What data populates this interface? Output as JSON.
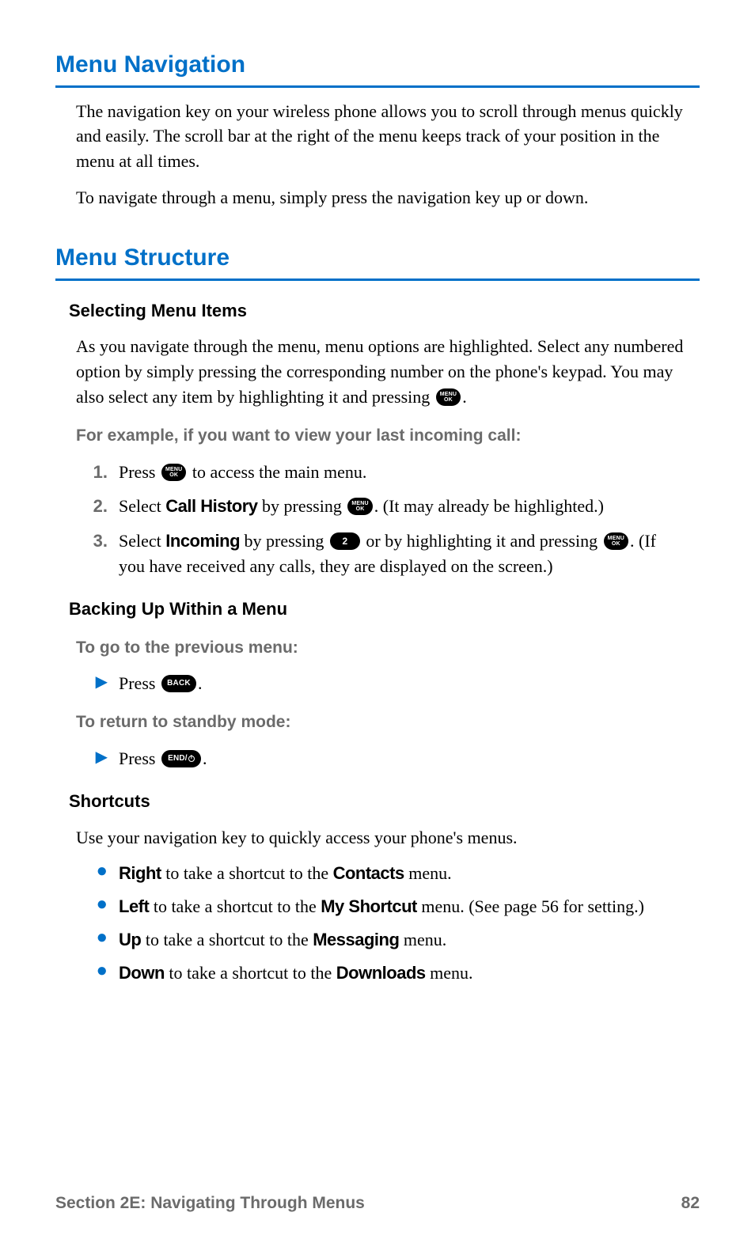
{
  "section1": {
    "heading": "Menu Navigation",
    "p1": "The navigation key on your wireless phone allows you to scroll through menus quickly and easily. The scroll bar at the right of the menu keeps track of your position in the menu at all times.",
    "p2": "To navigate through a menu, simply press the navigation key up or down."
  },
  "section2": {
    "heading": "Menu Structure",
    "sub1": "Selecting Menu Items",
    "sub1_p1": "As you navigate through the menu, menu options are highlighted. Select any numbered option by simply pressing the corresponding number on the phone's keypad. You may also select any item by highlighting it and pressing ",
    "sub1_p1_tail": ".",
    "example_lead": "For example, if you want to view your last incoming call:",
    "step1_num": "1.",
    "step1_a": "Press ",
    "step1_b": " to access the main menu.",
    "step2_num": "2.",
    "step2_a": "Select ",
    "step2_bold": "Call History",
    "step2_b": " by pressing ",
    "step2_c": ". (It may already be highlighted.)",
    "step3_num": "3.",
    "step3_a": "Select ",
    "step3_bold": "Incoming",
    "step3_b": " by pressing ",
    "step3_c": " or by highlighting it and pressing ",
    "step3_d": ". (If you have received any calls, they are displayed on the screen.)",
    "sub2": "Backing Up Within a Menu",
    "sub2_lead1": "To go to the previous menu:",
    "sub2_item1_a": "Press ",
    "sub2_item1_b": ".",
    "sub2_lead2": "To return to standby mode:",
    "sub2_item2_a": "Press ",
    "sub2_item2_b": ".",
    "sub3": "Shortcuts",
    "sub3_p1": "Use your navigation key to quickly access your phone's menus.",
    "sc1_a": "Right",
    "sc1_b": " to take a shortcut to the ",
    "sc1_c": "Contacts",
    "sc1_d": " menu.",
    "sc2_a": "Left",
    "sc2_b": " to take a shortcut to the ",
    "sc2_c": "My Shortcut",
    "sc2_d": " menu. (See page 56 for setting.)",
    "sc3_a": "Up",
    "sc3_b": " to take a shortcut to the ",
    "sc3_c": "Messaging",
    "sc3_d": " menu.",
    "sc4_a": "Down",
    "sc4_b": " to take a shortcut to the ",
    "sc4_c": "Downloads",
    "sc4_d": " menu."
  },
  "icons": {
    "menu_ok_l1": "MENU",
    "menu_ok_l2": "OK",
    "key2": "2",
    "back": "BACK",
    "end": "END/"
  },
  "footer": {
    "left": "Section 2E: Navigating Through Menus",
    "right": "82"
  }
}
